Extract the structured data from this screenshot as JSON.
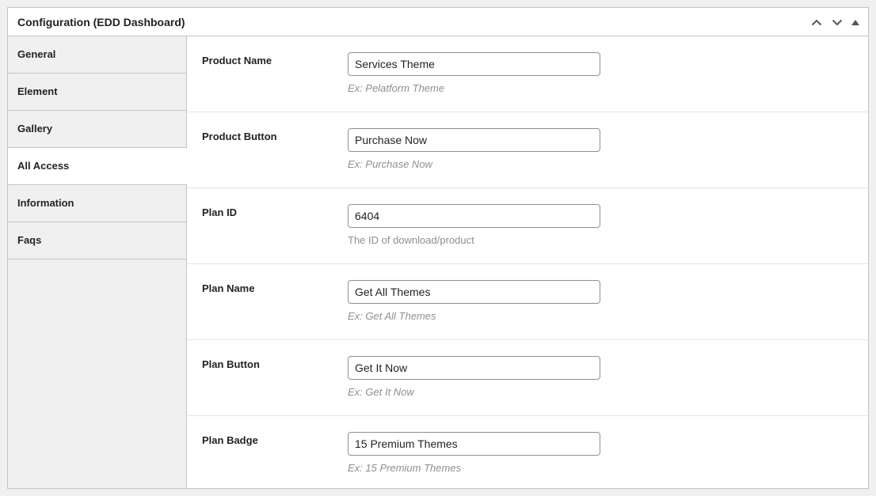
{
  "panel": {
    "title": "Configuration (EDD Dashboard)",
    "actions": [
      {
        "name": "move-up-icon"
      },
      {
        "name": "move-down-icon"
      },
      {
        "name": "toggle-panel-icon"
      }
    ]
  },
  "tabs": [
    {
      "label": "General",
      "active": false
    },
    {
      "label": "Element",
      "active": false
    },
    {
      "label": "Gallery",
      "active": false
    },
    {
      "label": "All Access",
      "active": true
    },
    {
      "label": "Information",
      "active": false
    },
    {
      "label": "Faqs",
      "active": false
    }
  ],
  "fields": [
    {
      "label": "Product Name",
      "value": "Services Theme",
      "description": "Ex: Pelatform Theme",
      "italic": true
    },
    {
      "label": "Product Button",
      "value": "Purchase Now",
      "description": "Ex: Purchase Now",
      "italic": true
    },
    {
      "label": "Plan ID",
      "value": "6404",
      "description": "The ID of download/product",
      "italic": false
    },
    {
      "label": "Plan Name",
      "value": "Get All Themes",
      "description": "Ex: Get All Themes",
      "italic": true
    },
    {
      "label": "Plan Button",
      "value": "Get It Now",
      "description": "Ex: Get It Now",
      "italic": true
    },
    {
      "label": "Plan Badge",
      "value": "15 Premium Themes",
      "description": "Ex: 15 Premium Themes",
      "italic": true
    }
  ],
  "colors": {
    "border": "#c3c4c7",
    "tab_background": "#f0f0f1",
    "description_text": "#8c8f94"
  }
}
